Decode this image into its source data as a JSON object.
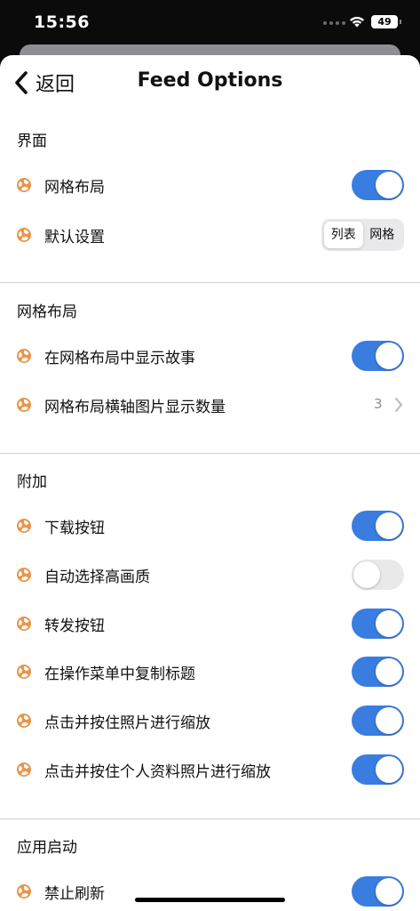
{
  "status": {
    "time": "15:56",
    "battery": "49"
  },
  "nav": {
    "back_label": "返回",
    "title": "Feed Options"
  },
  "sections": {
    "interface": {
      "header": "界面",
      "grid_layout": {
        "label": "网格布局",
        "on": true
      },
      "default_setting": {
        "label": "默认设置",
        "options": [
          "列表",
          "网格"
        ],
        "selected": "列表"
      }
    },
    "grid": {
      "header": "网格布局",
      "show_stories": {
        "label": "在网格布局中显示故事",
        "on": true
      },
      "horizontal_count": {
        "label": "网格布局横轴图片显示数量",
        "value": "3"
      }
    },
    "extras": {
      "header": "附加",
      "download_button": {
        "label": "下载按钮",
        "on": true
      },
      "auto_hq": {
        "label": "自动选择高画质",
        "on": false
      },
      "repost_button": {
        "label": "转发按钮",
        "on": true
      },
      "copy_caption": {
        "label": "在操作菜单中复制标题",
        "on": true
      },
      "zoom_photo": {
        "label": "点击并按住照片进行缩放",
        "on": true
      },
      "zoom_profile": {
        "label": "点击并按住个人资料照片进行缩放",
        "on": true
      }
    },
    "launch": {
      "header": "应用启动",
      "disable_refresh": {
        "label": "禁止刷新",
        "on": true
      }
    }
  },
  "colors": {
    "accent": "#3a7de0",
    "icon": "#e8954a"
  },
  "icons": {
    "row_icon": "tweak-icon",
    "back": "chevron-left-icon",
    "disclosure": "chevron-right-icon"
  }
}
